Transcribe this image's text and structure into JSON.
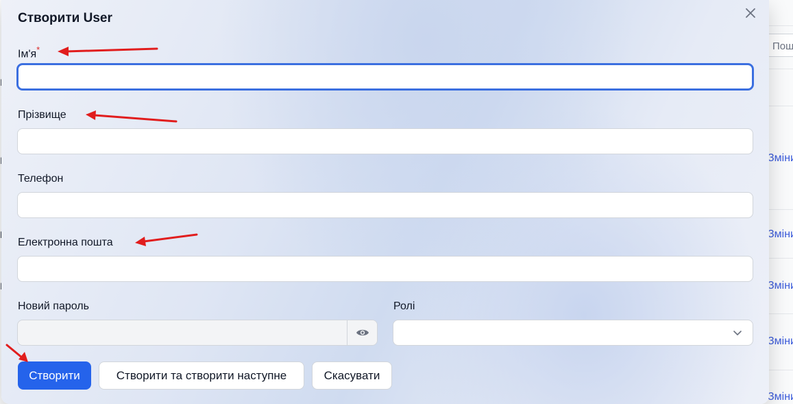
{
  "background": {
    "search_placeholder": "Пош",
    "row_links": [
      "Змінит",
      "Змінит",
      "Змінит",
      "Змінит",
      "Змінит"
    ],
    "left_chars": [
      "І",
      "І",
      "Е",
      "І"
    ]
  },
  "modal": {
    "title": "Створити User",
    "fields": {
      "first_name": {
        "label": "Ім'я",
        "required_mark": "*",
        "value": ""
      },
      "last_name": {
        "label": "Прізвище",
        "value": ""
      },
      "phone": {
        "label": "Телефон",
        "value": ""
      },
      "email": {
        "label": "Електронна пошта",
        "value": ""
      },
      "password": {
        "label": "Новий пароль",
        "value": ""
      },
      "roles": {
        "label": "Ролі",
        "value": ""
      }
    },
    "buttons": {
      "create": "Створити",
      "create_another": "Створити та створити наступне",
      "cancel": "Скасувати"
    }
  },
  "colors": {
    "primary": "#2563eb",
    "focus_ring": "#3b6fe0",
    "required": "#dc2626",
    "annotation_arrow": "#e11d1d"
  },
  "icons": [
    "close-icon",
    "eye-icon",
    "chevron-down-icon"
  ]
}
